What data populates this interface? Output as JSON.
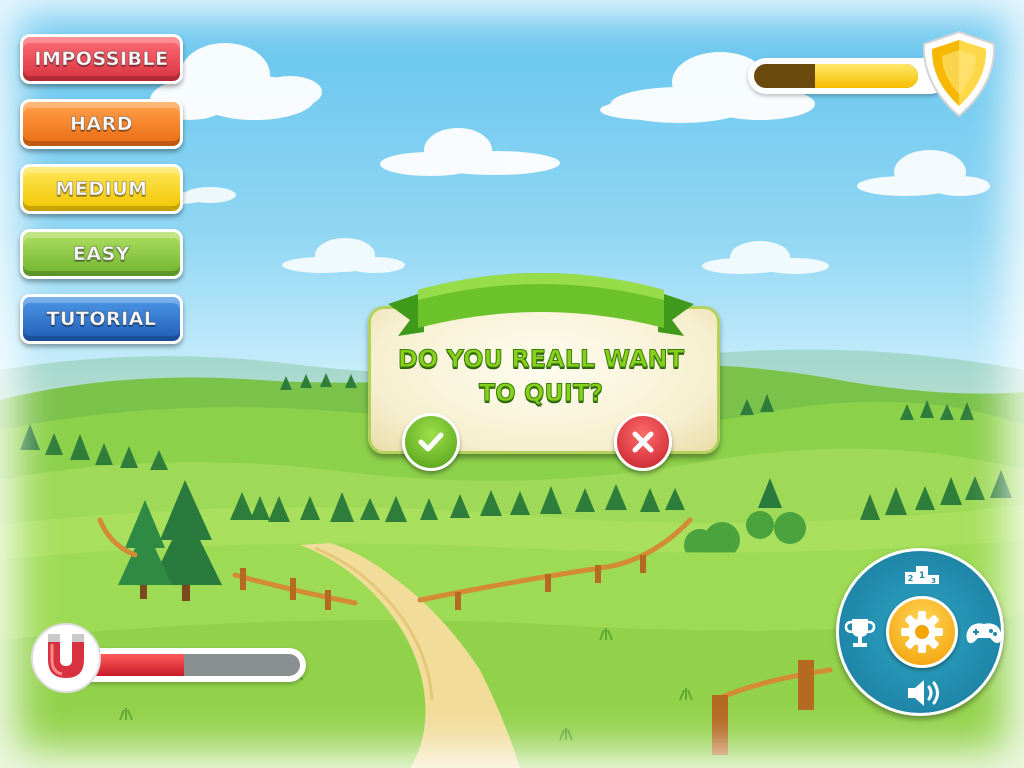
{
  "difficulty_menu": {
    "impossible_label": "IMPOSSIBLE",
    "hard_label": "HARD",
    "medium_label": "MEDIUM",
    "easy_label": "EASY",
    "tutorial_label": "TUTORIAL"
  },
  "quit_dialog": {
    "message_line1": "DO YOU REALL WANT",
    "message_line2": "TO QUIT?",
    "confirm_icon": "check-icon",
    "cancel_icon": "cross-icon"
  },
  "shield_meter": {
    "icon": "shield-icon",
    "fill_fraction": 0.63,
    "fill_color": "#f6bd00"
  },
  "magnet_meter": {
    "icon": "magnet-icon",
    "fill_fraction": 0.46,
    "fill_color": "#d8313f"
  },
  "radial_menu": {
    "items": [
      "leaderboard-podium-icon",
      "trophy-icon",
      "settings-gear-icon",
      "gamepad-icon",
      "sound-icon"
    ],
    "center": "settings-gear-icon"
  },
  "colors": {
    "impossible": "#d8313f",
    "hard": "#ea6a12",
    "medium": "#f2c500",
    "easy": "#6fb42e",
    "tutorial": "#1f5cb8",
    "dialog_text": "#87d11c",
    "radial_menu": "#1f86a8"
  }
}
